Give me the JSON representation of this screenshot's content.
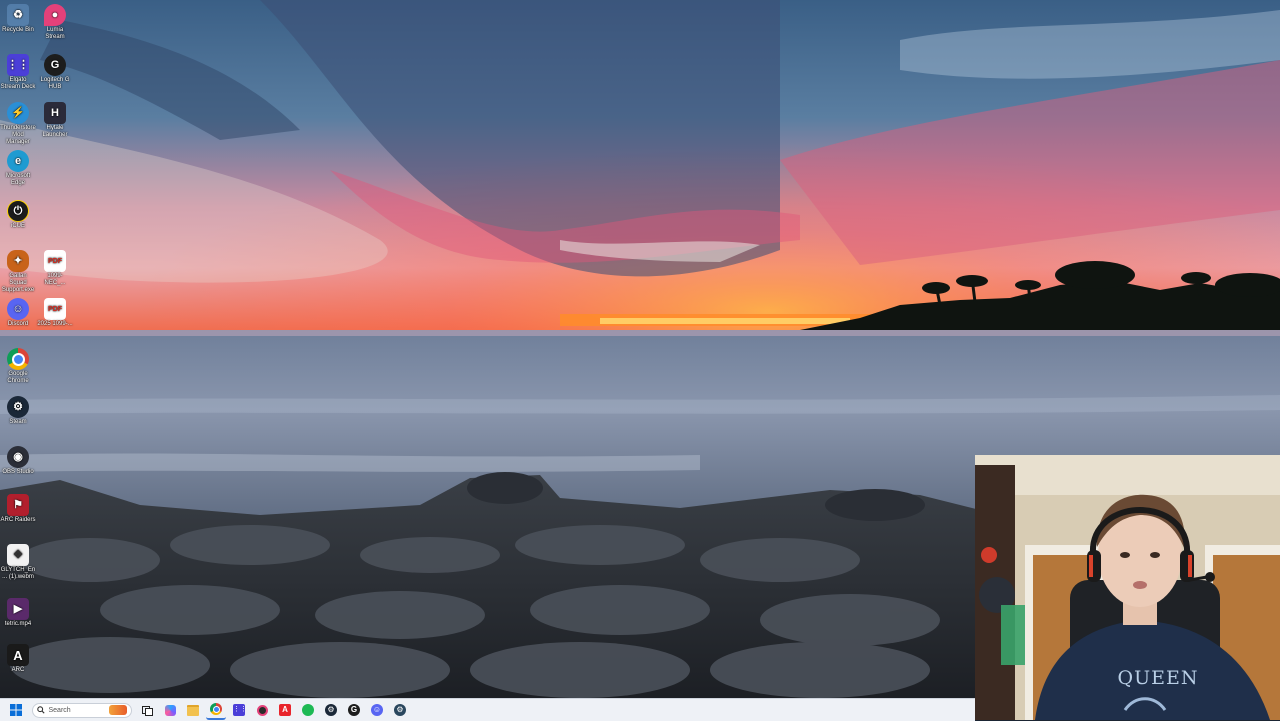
{
  "desktop": {
    "icons": [
      {
        "label": "Recycle Bin",
        "icon": "recycle-bin-icon",
        "color": "#7fb2e6"
      },
      {
        "label": "Lumia Stream",
        "icon": "lumia-stream-icon",
        "color": "#e4417a"
      },
      {
        "label": "Elgato Stream Deck",
        "icon": "stream-deck-icon",
        "color": "#4b3fd8"
      },
      {
        "label": "Logitech G HUB",
        "icon": "logitech-ghub-icon",
        "color": "#1d1d1d"
      },
      {
        "label": "Thunderstore Mod Manager",
        "icon": "thunderstore-icon",
        "color": "#2a8fd6"
      },
      {
        "label": "Hytale Launcher",
        "icon": "hytale-launcher-icon",
        "color": "#2b2b3a"
      },
      {
        "label": "Microsoft Edge",
        "icon": "edge-icon",
        "color": "#1f9bd1"
      },
      {
        "label": "iCUE",
        "icon": "icue-icon",
        "color": "#1c1c1c"
      },
      {
        "label": "Gallan Squad Support.exe",
        "icon": "game-exe-icon",
        "color": "#c8631a"
      },
      {
        "label": "1099-NEC_...",
        "icon": "pdf-icon",
        "color": "#d93025"
      },
      {
        "label": "Discord",
        "icon": "discord-icon",
        "color": "#5865f2"
      },
      {
        "label": "2025 1099-...",
        "icon": "pdf-icon",
        "color": "#d93025"
      },
      {
        "label": "Google Chrome",
        "icon": "chrome-icon",
        "color": "#db4437"
      },
      {
        "label": "Steam",
        "icon": "steam-icon",
        "color": "#1b2838"
      },
      {
        "label": "OBS Studio",
        "icon": "obs-icon",
        "color": "#2b2e38"
      },
      {
        "label": "ARC Raiders",
        "icon": "arc-raiders-icon",
        "color": "#b21f2d"
      },
      {
        "label": "GLYTCH_En... (1).webm",
        "icon": "video-file-icon",
        "color": "#ffffff"
      },
      {
        "label": "tetric.mp4",
        "icon": "video-file-icon",
        "color": "#5a2a6a"
      },
      {
        "label": "ARC",
        "icon": "arc-icon",
        "color": "#1a1a1a"
      }
    ]
  },
  "taskbar": {
    "search_placeholder": "Search",
    "apps": [
      {
        "name": "file-explorer",
        "color": "#f2c14e"
      },
      {
        "name": "copilot",
        "color": "#7b5cff"
      },
      {
        "name": "file-manager",
        "color": "#f0b429"
      },
      {
        "name": "chrome",
        "color": "#db4437"
      },
      {
        "name": "stream-deck",
        "color": "#4b3fd8"
      },
      {
        "name": "lumia-stream",
        "color": "#e4417a"
      },
      {
        "name": "adobe-express",
        "color": "#e8242c"
      },
      {
        "name": "spotify",
        "color": "#1db954"
      },
      {
        "name": "steam",
        "color": "#1b2838"
      },
      {
        "name": "logitech-ghub",
        "color": "#1d1d1d"
      },
      {
        "name": "discord",
        "color": "#5865f2"
      },
      {
        "name": "steam-alt",
        "color": "#2a475e"
      }
    ]
  },
  "webcam": {
    "shirt_text": "QUEEN"
  }
}
